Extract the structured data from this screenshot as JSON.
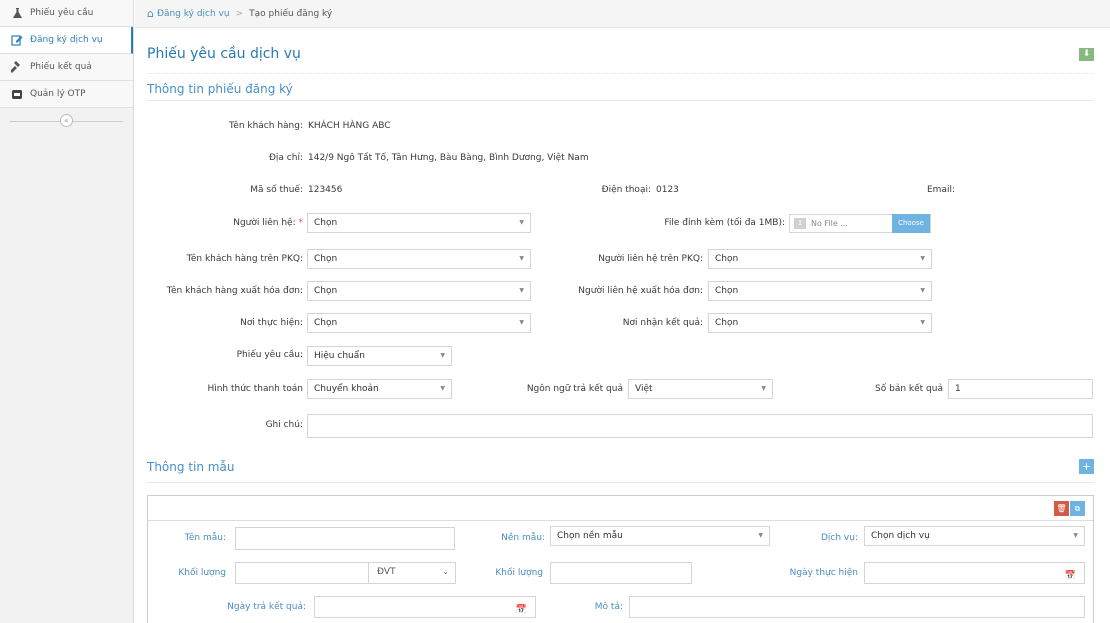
{
  "sidebar": {
    "items": [
      {
        "label": "Phiếu yêu cầu",
        "icon": "flask-icon"
      },
      {
        "label": "Đăng ký dịch vụ",
        "icon": "edit-icon"
      },
      {
        "label": "Phiếu kết quả",
        "icon": "gavel-icon"
      },
      {
        "label": "Quản lý OTP",
        "icon": "envelope-icon"
      }
    ],
    "toggle": "«"
  },
  "breadcrumb": {
    "home_label": "Đăng ký dịch vụ",
    "current": "Tạo phiếu đăng ký"
  },
  "page": {
    "title": "Phiếu yêu cầu dịch vụ",
    "section1": "Thông tin phiếu đăng ký",
    "section2": "Thông tin mẫu"
  },
  "form": {
    "customer_name_label": "Tên khách hàng:",
    "customer_name": "KHÁCH HÀNG ABC",
    "address_label": "Địa chỉ:",
    "address": "142/9 Ngô Tất Tố, Tân Hưng, Bàu Bàng, Bình Dương, Việt Nam",
    "tax_label": "Mã số thuế:",
    "tax": "123456",
    "phone_label": "Điện thoại:",
    "phone": "0123",
    "email_label": "Email:",
    "contact_label": "Người liên hệ:",
    "contact_value": "Chọn",
    "attach_label": "File đính kèm (tối đa 1MB):",
    "attach_placeholder": "No File ...",
    "attach_button": "Choose",
    "pkq_customer_label": "Tên khách hàng trên PKQ:",
    "pkq_customer_value": "Chọn",
    "pkq_contact_label": "Người liên hệ trên PKQ:",
    "pkq_contact_value": "Chọn",
    "invoice_customer_label": "Tên khách hàng xuất hóa đơn:",
    "invoice_customer_value": "Chọn",
    "invoice_contact_label": "Người liên hệ xuất hóa đơn:",
    "invoice_contact_value": "Chọn",
    "place_label": "Nơi thực hiện:",
    "place_value": "Chọn",
    "receive_label": "Nơi nhận kết quả:",
    "receive_value": "Chọn",
    "request_label": "Phiếu yêu cầu:",
    "request_value": "Hiệu chuẩn",
    "payment_label": "Hình thức thanh toán",
    "payment_value": "Chuyển khoản",
    "lang_label": "Ngôn ngữ trả kết quả",
    "lang_value": "Việt",
    "copies_label": "Số bản kết quả",
    "copies_value": "1",
    "note_label": "Ghi chú:"
  },
  "sample": {
    "name_label": "Tên mẫu:",
    "matrix_label": "Nền mẫu:",
    "matrix_value": "Chọn nền mẫu",
    "service_label": "Dịch vụ:",
    "service_value": "Chọn dịch vụ",
    "weight_label": "Khối lượng",
    "unit_value": "ĐVT",
    "weight2_label": "Khối lượng",
    "exec_date_label": "Ngày thực hiện",
    "return_date_label": "Ngày trả kết quả:",
    "desc_label": "Mô tả:"
  }
}
